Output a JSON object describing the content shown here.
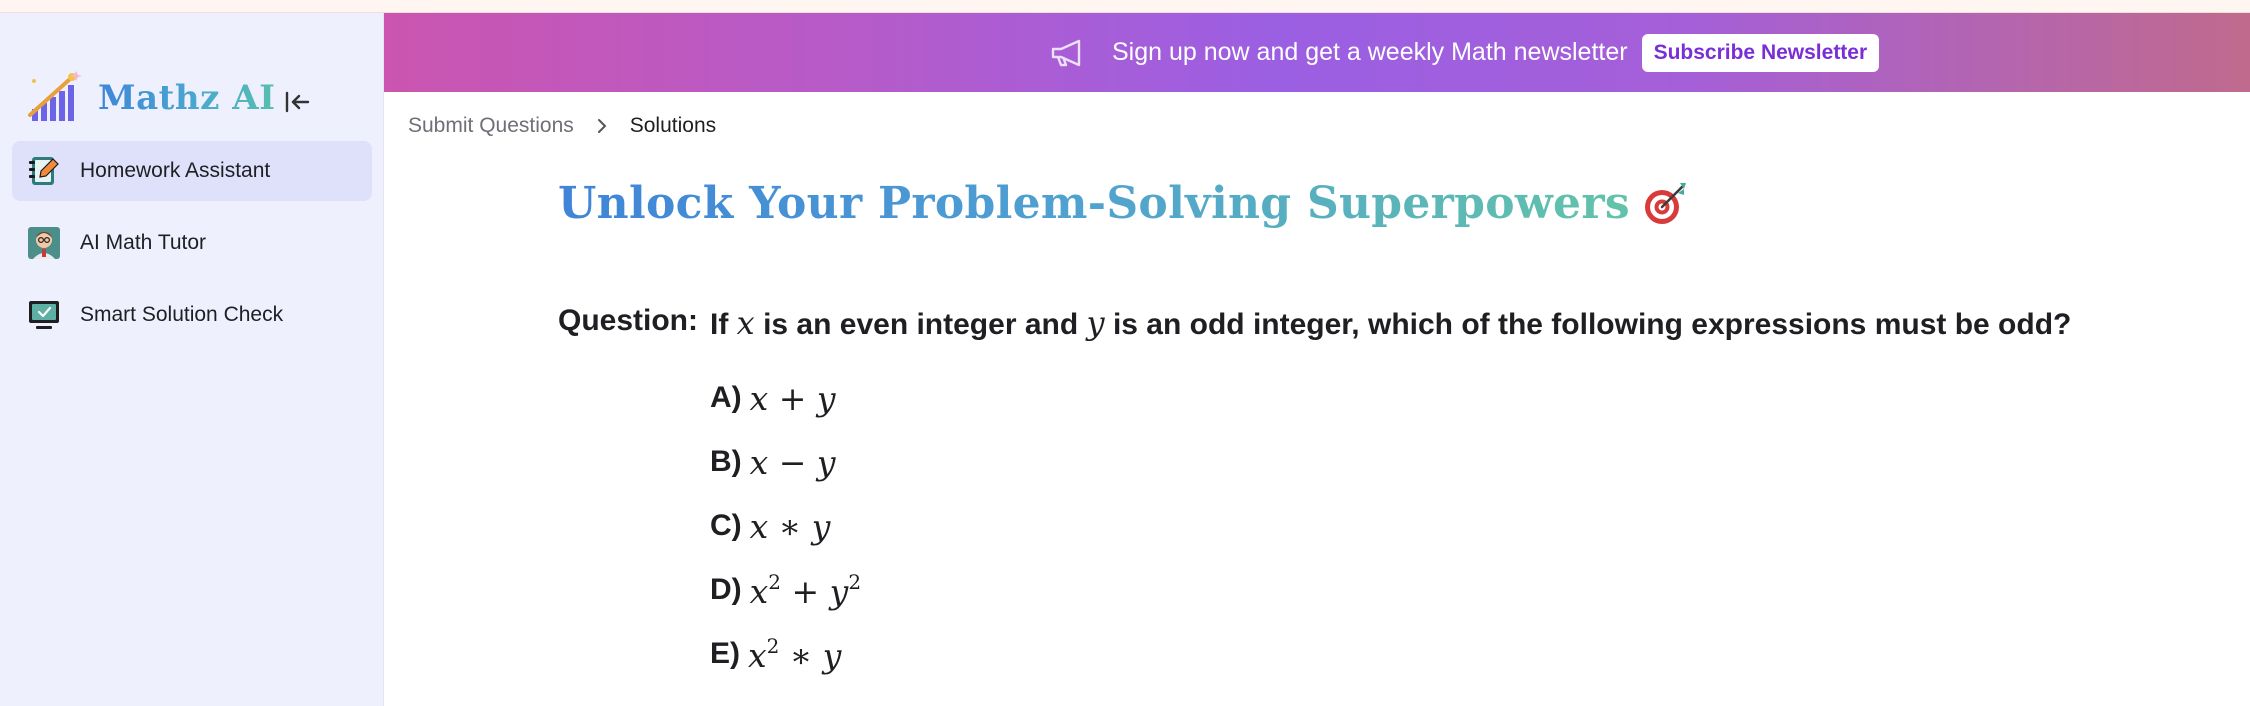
{
  "app": {
    "name": "Mathz AI"
  },
  "sidebar": {
    "collapse_icon": "collapse-left-icon",
    "items": [
      {
        "label": "Homework Assistant",
        "icon": "notebook-pencil-icon",
        "active": true
      },
      {
        "label": "AI Math Tutor",
        "icon": "tutor-avatar-icon",
        "active": false
      },
      {
        "label": "Smart Solution Check",
        "icon": "monitor-check-icon",
        "active": false
      }
    ]
  },
  "banner": {
    "icon": "megaphone-icon",
    "text": "Sign up now and get a weekly Math newsletter",
    "button_label": "Subscribe Newsletter"
  },
  "breadcrumb": {
    "items": [
      "Submit Questions",
      "Solutions"
    ]
  },
  "main": {
    "title": "Unlock Your Problem-Solving Superpowers",
    "title_icon": "target-dart-icon",
    "question": {
      "label": "Question:",
      "parts": {
        "p1": "If",
        "x": "x",
        "p2": "is an even integer and",
        "y": "y",
        "p3": "is an odd integer, which of the following expressions must be odd?"
      },
      "options": [
        {
          "letter": "A)",
          "expr": [
            "x",
            " + ",
            "y"
          ]
        },
        {
          "letter": "B)",
          "expr": [
            "x",
            " − ",
            "y"
          ]
        },
        {
          "letter": "C)",
          "expr": [
            "x",
            " ∗ ",
            "y"
          ]
        },
        {
          "letter": "D)",
          "expr": [
            "x",
            "2",
            " + ",
            "y",
            "2"
          ]
        },
        {
          "letter": "E)",
          "expr": [
            "x",
            "2",
            " ∗ ",
            "y"
          ]
        }
      ]
    }
  },
  "colors": {
    "sidebar_bg": "#eff0fe",
    "active_item_bg": "#dfe1fb",
    "banner_gradient": [
      "#cb55b0",
      "#9b5fe3",
      "#c06a8d"
    ],
    "subscribe_text": "#7a2fd6",
    "title_gradient": [
      "#3f84d8",
      "#62c3a9"
    ]
  }
}
